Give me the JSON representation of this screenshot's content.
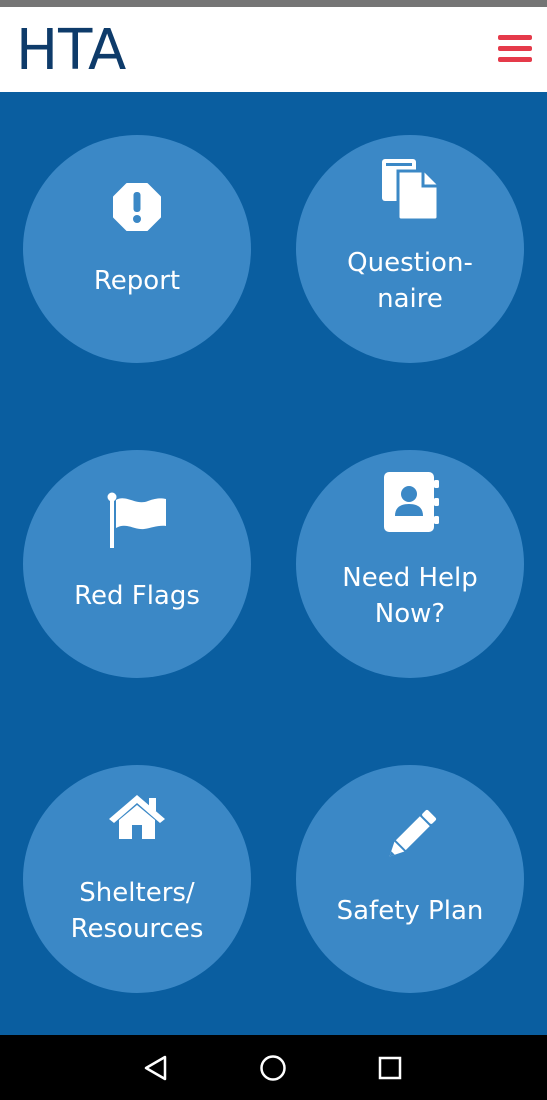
{
  "header": {
    "title": "HTA",
    "menu_icon": "hamburger-menu-icon",
    "menu_color": "#e53a4a"
  },
  "colors": {
    "background": "#0a5ea0",
    "tile": "#3b88c6",
    "title": "#0e3b6a"
  },
  "tiles": [
    {
      "label": "Report",
      "icon": "octagon-exclamation-icon"
    },
    {
      "label": "Question-\nnaire",
      "icon": "documents-icon"
    },
    {
      "label": "Red Flags",
      "icon": "flag-icon"
    },
    {
      "label": "Need Help\nNow?",
      "icon": "address-book-icon"
    },
    {
      "label": "Shelters/\nResources",
      "icon": "home-icon"
    },
    {
      "label": "Safety Plan",
      "icon": "pencil-icon"
    }
  ],
  "nav_bar": {
    "back_icon": "back-triangle-icon",
    "home_icon": "home-circle-icon",
    "recents_icon": "recents-square-icon"
  }
}
